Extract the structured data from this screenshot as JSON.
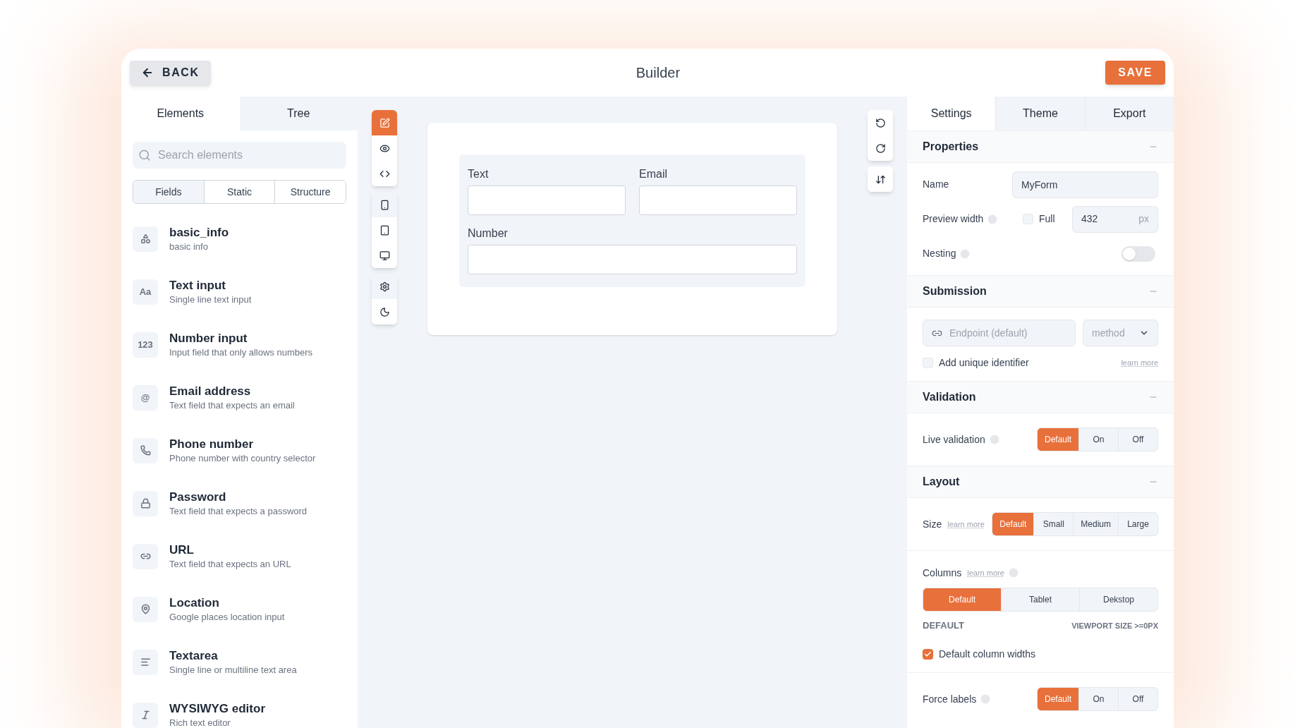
{
  "header": {
    "back": "BACK",
    "title": "Builder",
    "save": "SAVE"
  },
  "left_tabs": [
    {
      "label": "Elements",
      "selected": true
    },
    {
      "label": "Tree",
      "selected": false
    }
  ],
  "search": {
    "placeholder": "Search elements"
  },
  "filter_tabs": [
    {
      "label": "Fields",
      "selected": true
    },
    {
      "label": "Static",
      "selected": false
    },
    {
      "label": "Structure",
      "selected": false
    }
  ],
  "elements": [
    {
      "kind": "shapes",
      "title": "basic_info",
      "description": "basic info"
    },
    {
      "kind": "glyph",
      "glyph": "Aa",
      "title": "Text input",
      "description": "Single line text input"
    },
    {
      "kind": "glyph",
      "glyph": "123",
      "title": "Number input",
      "description": "Input field that only allows numbers"
    },
    {
      "kind": "glyph",
      "glyph": "@",
      "title": "Email address",
      "description": "Text field that expects an email"
    },
    {
      "kind": "phone",
      "title": "Phone number",
      "description": "Phone number with country selector"
    },
    {
      "kind": "lock",
      "title": "Password",
      "description": "Text field that expects a password"
    },
    {
      "kind": "link",
      "title": "URL",
      "description": "Text field that expects an URL"
    },
    {
      "kind": "pin",
      "title": "Location",
      "description": "Google places location input"
    },
    {
      "kind": "lines",
      "title": "Textarea",
      "description": "Single line or multiline text area"
    },
    {
      "kind": "italic",
      "title": "WYSIWYG editor",
      "description": "Rich text editor"
    }
  ],
  "toolbar": [
    {
      "kind": "mode",
      "tools": [
        {
          "kind": "edit",
          "selected": true
        },
        {
          "kind": "eye",
          "selected": false
        },
        {
          "kind": "code",
          "selected": false
        }
      ]
    },
    {
      "kind": "device",
      "tools": [
        {
          "kind": "mobile",
          "selected": true
        },
        {
          "kind": "tablet",
          "selected": false
        },
        {
          "kind": "desktop",
          "selected": false
        }
      ]
    },
    {
      "kind": "device",
      "tools": [
        {
          "kind": "gear",
          "selected": true
        },
        {
          "kind": "moon",
          "selected": false
        }
      ]
    }
  ],
  "history_toolbar": [
    {
      "tools": [
        {
          "kind": "undo"
        },
        {
          "kind": "redo"
        }
      ]
    },
    {
      "tools": [
        {
          "kind": "sort"
        }
      ]
    }
  ],
  "form_preview": {
    "rows": [
      [
        {
          "label": "Text"
        },
        {
          "label": "Email"
        }
      ],
      [
        {
          "label": "Number"
        }
      ]
    ]
  },
  "right_tabs": [
    {
      "label": "Settings",
      "selected": true
    },
    {
      "label": "Theme",
      "selected": false
    },
    {
      "label": "Export",
      "selected": false
    }
  ],
  "sections": [
    {
      "title": "Properties",
      "expanded": true,
      "groups": [
        [
          {
            "kind": "text-field",
            "label": "Name",
            "value": "MyForm"
          },
          {
            "kind": "width",
            "label": "Preview width",
            "info": true,
            "checkbox_label": "Full",
            "checked": false,
            "value": "432",
            "unit": "px"
          },
          {
            "kind": "toggle",
            "label": "Nesting",
            "info": true,
            "on": false
          }
        ]
      ]
    },
    {
      "title": "Submission",
      "expanded": true,
      "groups": [
        [
          {
            "kind": "endpoint",
            "placeholder": "Endpoint (default)",
            "select_placeholder": "method"
          },
          {
            "kind": "checkbox",
            "label": "Add unique identifier",
            "checked": false,
            "link": "learn more"
          }
        ]
      ]
    },
    {
      "title": "Validation",
      "expanded": true,
      "groups": [
        [
          {
            "kind": "segmented",
            "label": "Live validation",
            "info": true,
            "options": [
              {
                "label": "Default",
                "selected": true
              },
              {
                "label": "On",
                "selected": false
              },
              {
                "label": "Off",
                "selected": false
              }
            ]
          }
        ]
      ]
    },
    {
      "title": "Layout",
      "expanded": true,
      "groups": [
        [
          {
            "kind": "segmented",
            "label": "Size",
            "link": "learn more",
            "options": [
              {
                "label": "Default",
                "selected": true
              },
              {
                "label": "Small",
                "selected": false
              },
              {
                "label": "Medium",
                "selected": false
              },
              {
                "label": "Large",
                "selected": false
              }
            ]
          }
        ],
        [
          {
            "kind": "columns",
            "label": "Columns",
            "link": "learn more",
            "info": true,
            "options": [
              {
                "label": "Default",
                "selected": true
              },
              {
                "label": "Tablet",
                "selected": false
              },
              {
                "label": "Dekstop",
                "selected": false
              }
            ],
            "caption": "DEFAULT",
            "note": "VIEWPORT SIZE >=0PX"
          },
          {
            "kind": "checkbox",
            "label": "Default column widths",
            "checked": true
          }
        ],
        [
          {
            "kind": "segmented",
            "label": "Force labels",
            "info": true,
            "options": [
              {
                "label": "Default",
                "selected": true
              },
              {
                "label": "On",
                "selected": false
              },
              {
                "label": "Off",
                "selected": false
              }
            ]
          }
        ]
      ]
    }
  ]
}
